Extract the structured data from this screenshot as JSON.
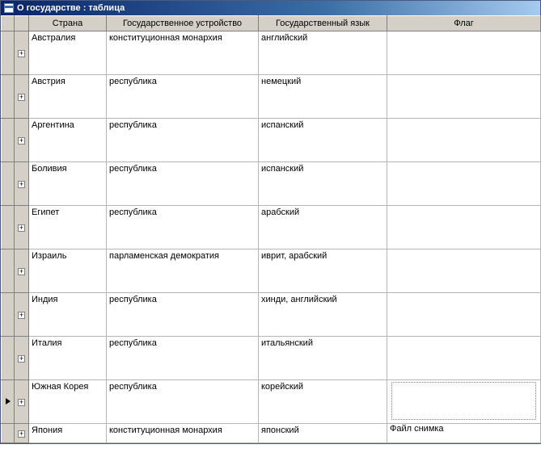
{
  "window": {
    "title": "О государстве : таблица"
  },
  "columns": {
    "country": "Страна",
    "government": "Государственное устройство",
    "language": "Государственный язык",
    "flag": "Флаг"
  },
  "expander_glyph": "+",
  "rows": [
    {
      "country": "Австралия",
      "government": "конституционная монархия",
      "language": "английский",
      "selected": false,
      "flag_caption": ""
    },
    {
      "country": "Австрия",
      "government": "республика",
      "language": "немецкий",
      "selected": false,
      "flag_caption": ""
    },
    {
      "country": "Аргентина",
      "government": "республика",
      "language": "испанский",
      "selected": false,
      "flag_caption": ""
    },
    {
      "country": "Боливия",
      "government": "республика",
      "language": "испанский",
      "selected": false,
      "flag_caption": ""
    },
    {
      "country": "Египет",
      "government": "республика",
      "language": "арабский",
      "selected": false,
      "flag_caption": ""
    },
    {
      "country": "Израиль",
      "government": "парламенская демократия",
      "language": "иврит, арабский",
      "selected": false,
      "flag_caption": ""
    },
    {
      "country": "Индия",
      "government": "республика",
      "language": "хинди, английский",
      "selected": false,
      "flag_caption": ""
    },
    {
      "country": "Италия",
      "government": "республика",
      "language": "итальянский",
      "selected": false,
      "flag_caption": ""
    },
    {
      "country": "Южная Корея",
      "government": "республика",
      "language": "корейский",
      "selected": true,
      "flag_caption": ""
    },
    {
      "country": "Япония",
      "government": "конституционная монархия",
      "language": "японский",
      "selected": false,
      "flag_caption": "Файл снимка"
    }
  ]
}
